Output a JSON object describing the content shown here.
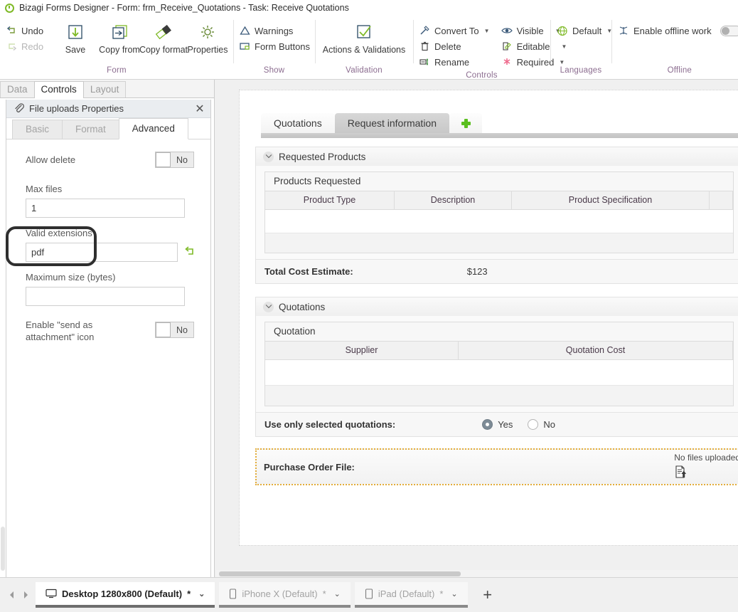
{
  "window": {
    "title": "Bizagi Forms Designer  - Form: frm_Receive_Quotations - Task:  Receive Quotations",
    "logo_icon": "bizagi-logo-icon"
  },
  "ribbon": {
    "groups": [
      {
        "label": "Form",
        "small_commands": [
          {
            "label": "Undo",
            "icon": "undo-icon",
            "disabled": false
          },
          {
            "label": "Redo",
            "icon": "redo-icon",
            "disabled": true
          }
        ],
        "big_commands": [
          {
            "label": "Save",
            "icon": "save-icon"
          },
          {
            "label": "Copy from",
            "icon": "copy-from-icon"
          },
          {
            "label": "Copy format",
            "icon": "copy-format-icon"
          },
          {
            "label": "Properties",
            "icon": "gear-icon"
          }
        ]
      },
      {
        "label": "Show",
        "small_commands": [
          {
            "label": "Warnings",
            "icon": "warning-triangle-icon"
          },
          {
            "label": "Form Buttons",
            "icon": "form-buttons-icon"
          }
        ]
      },
      {
        "label": "Validation",
        "big_commands": [
          {
            "label": "Actions & Validations",
            "icon": "check-box-icon"
          }
        ]
      },
      {
        "label": "Controls",
        "small_commands": [
          {
            "label": "Convert To",
            "icon": "convert-to-icon",
            "caret": true
          },
          {
            "label": "Delete",
            "icon": "trash-icon",
            "caret": false
          },
          {
            "label": "Rename",
            "icon": "rename-icon",
            "caret": false
          }
        ],
        "small_commands_2": [
          {
            "label": "Visible",
            "icon": "eye-icon",
            "caret": true,
            "caret_spaced": true
          },
          {
            "label": "Editable",
            "icon": "editable-icon",
            "caret": true,
            "caret_spaced": true
          },
          {
            "label": "Required",
            "icon": "asterisk-icon",
            "caret": true,
            "caret_spaced": false
          }
        ]
      },
      {
        "label": "Languages",
        "small_commands": [
          {
            "label": "Default",
            "icon": "globe-icon",
            "caret": true
          }
        ]
      },
      {
        "label": "Offline",
        "small_commands": [
          {
            "label": "Enable offline work",
            "icon": "offline-icon",
            "toggle": "off"
          }
        ]
      }
    ]
  },
  "left_panel": {
    "tabs": [
      {
        "label": "Data",
        "active": false
      },
      {
        "label": "Controls",
        "active": true
      },
      {
        "label": "Layout",
        "active": false
      }
    ],
    "properties": {
      "icon": "paperclip-icon",
      "title": "File uploads Properties",
      "close_icon": "close-icon",
      "subtabs": [
        {
          "label": "Basic",
          "active": false
        },
        {
          "label": "Format",
          "active": false
        },
        {
          "label": "Advanced",
          "active": true
        }
      ],
      "fields": {
        "allow_delete": {
          "label": "Allow delete",
          "value": "No"
        },
        "max_files": {
          "label": "Max files",
          "value": "1",
          "placeholder": ""
        },
        "valid_extensions": {
          "label": "Valid extensions",
          "value": "pdf",
          "placeholder": "",
          "reset_icon": "reset-arrow-icon",
          "highlighted": true
        },
        "maximum_size": {
          "label": "Maximum size (bytes)",
          "value": "",
          "placeholder": ""
        },
        "send_as_attachment": {
          "label": "Enable \"send as attachment\" icon",
          "value": "No"
        }
      }
    }
  },
  "canvas": {
    "form_tabs": [
      {
        "label": "Quotations",
        "active": true
      },
      {
        "label": "Request information",
        "active": false
      }
    ],
    "add_tab_icon": "plus-icon",
    "sections": [
      {
        "title": "Requested Products",
        "collapse_icon": "chevron-down-icon",
        "grid": {
          "title": "Products Requested",
          "columns": [
            "Product Type",
            "Description",
            "Product Specification"
          ],
          "rows": []
        },
        "total": {
          "label": "Total Cost Estimate:",
          "value": "$123"
        }
      },
      {
        "title": "Quotations",
        "collapse_icon": "chevron-down-icon",
        "grid": {
          "title": "Quotation",
          "columns": [
            "Supplier",
            "Quotation Cost"
          ],
          "rows": []
        },
        "radio_field": {
          "label": "Use only selected quotations:",
          "options": [
            {
              "label": "Yes",
              "selected": true
            },
            {
              "label": "No",
              "selected": false
            }
          ]
        }
      }
    ],
    "file_upload": {
      "label": "Purchase Order File:",
      "status": "No files uploaded",
      "icon": "file-upload-icon"
    }
  },
  "bottom_bar": {
    "prev_icon": "nav-prev-icon",
    "next_icon": "nav-next-icon",
    "device_tabs": [
      {
        "label": "Desktop 1280x800 (Default)",
        "star": "*",
        "icon": "monitor-icon",
        "active": true
      },
      {
        "label": "iPhone X (Default)",
        "star": "*",
        "icon": "phone-icon",
        "active": false
      },
      {
        "label": "iPad (Default)",
        "star": "*",
        "icon": "tablet-icon",
        "active": false
      }
    ],
    "add_label": "+"
  },
  "colors": {
    "brand_green": "#7fba27",
    "group_label": "#8b6c8f",
    "highlight_border": "#2f2f2f",
    "file_row_border": "#e3ad3b"
  }
}
